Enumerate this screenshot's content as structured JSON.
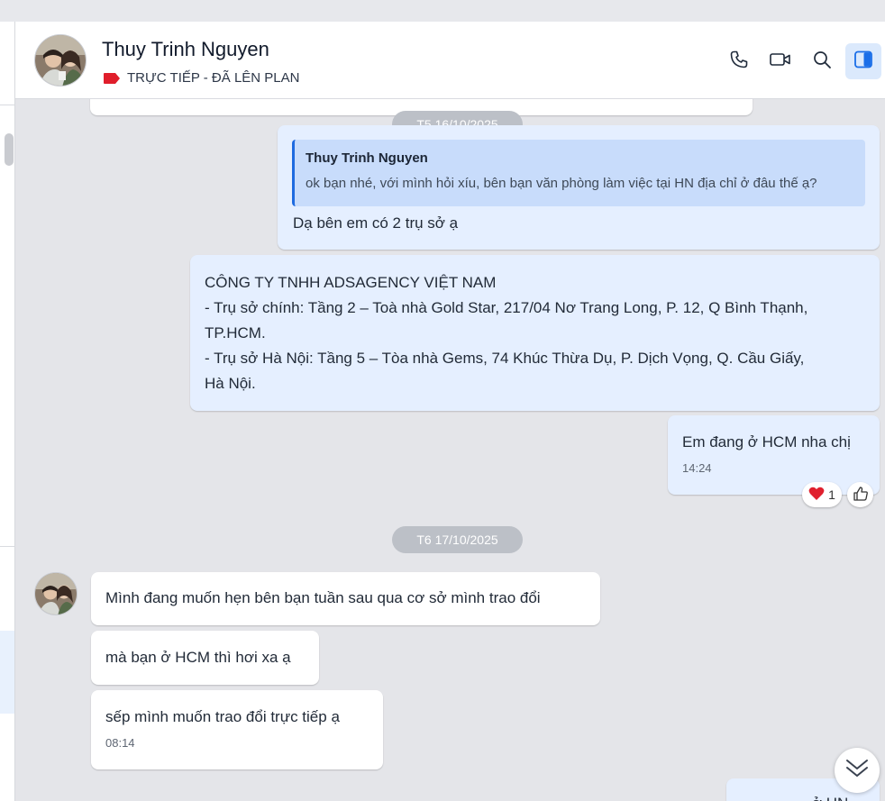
{
  "header": {
    "contact_name": "Thuy Trinh Nguyen",
    "tag_label": "TRỰC TIẾP - ĐÃ LÊN PLAN",
    "tag_color": "#e01e2b",
    "icons": [
      "phone-icon",
      "video-call-icon",
      "search-icon",
      "side-panel-icon"
    ]
  },
  "messages": {
    "date_1": "T5 16/10/2025",
    "reply": {
      "quote_name": "Thuy Trinh Nguyen",
      "quote_text": "ok bạn nhé, với mình hỏi xíu, bên bạn văn phòng làm việc tại HN địa chỉ ở đâu thế ạ?",
      "text": "Dạ bên em có 2 trụ sở ạ"
    },
    "address": {
      "line1": "CÔNG TY TNHH ADSAGENCY VIỆT NAM",
      "line2": "- Trụ sở chính: Tầng 2 – Toà nhà Gold Star, 217/04 Nơ Trang Long, P. 12, Q Bình Thạnh,",
      "line3": "TP.HCM.",
      "line4": "- Trụ sở Hà Nội: Tầng 5 –  Tòa nhà Gems, 74 Khúc Thừa Dụ, P. Dịch Vọng, Q. Cầu Giấy,",
      "line5": "Hà Nội."
    },
    "hcm": {
      "text": "Em đang ở HCM nha chị",
      "time": "14:24",
      "reaction_count": "1",
      "reaction_icon": "heart-icon"
    },
    "date_2": "T6 17/10/2025",
    "incoming_1": "Mình đang muốn hẹn bên bạn tuần sau qua cơ sở mình trao đổi",
    "incoming_2": "mà bạn ở HCM thì hơi xa ạ",
    "incoming_3": "sếp mình muốn trao đổi trực tiếp ạ",
    "incoming_3_time": "08:14",
    "partial_text": "... ở HN"
  },
  "colors": {
    "outgoing_bubble": "#e5efff",
    "incoming_bubble": "#ffffff",
    "quote_bar": "#1e6ae0",
    "date_pill": "#bcc0c7"
  }
}
